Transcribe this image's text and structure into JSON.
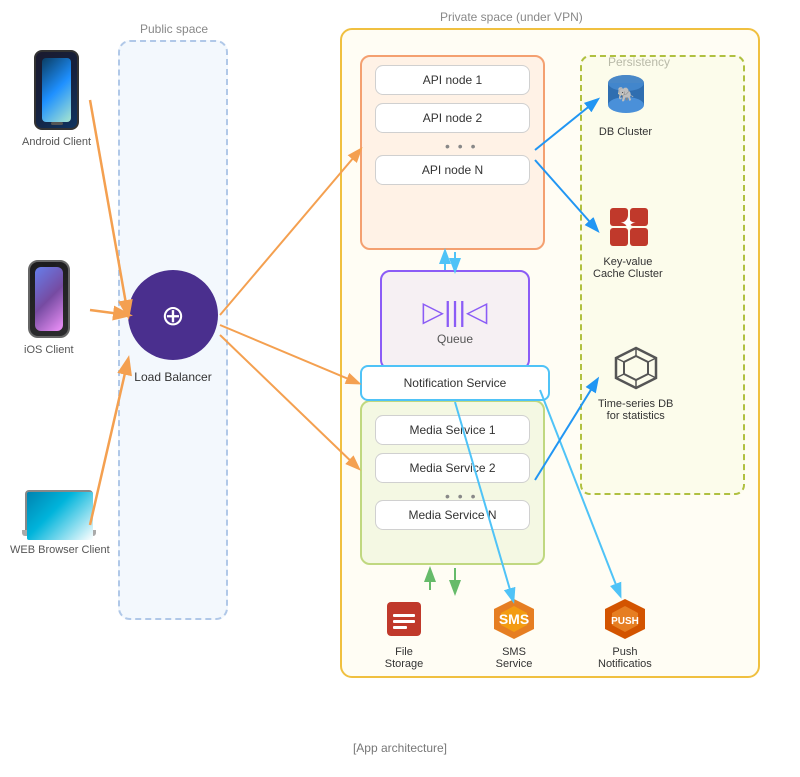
{
  "title": "App architecture",
  "zones": {
    "public_space": "Public space",
    "private_space": "Private space (under VPN)",
    "persistency": "Persistency"
  },
  "clients": [
    {
      "id": "android",
      "label": "Android Client",
      "type": "android"
    },
    {
      "id": "ios",
      "label": "iOS Client",
      "type": "ios"
    },
    {
      "id": "web",
      "label": "WEB Browser Client",
      "type": "laptop"
    }
  ],
  "load_balancer": {
    "label": "Load Balancer"
  },
  "api_nodes": [
    {
      "label": "API node 1"
    },
    {
      "label": "API node 2"
    },
    {
      "label": "..."
    },
    {
      "label": "API node N"
    }
  ],
  "queue": {
    "label": "Queue"
  },
  "notification_service": {
    "label": "Notification Service"
  },
  "media_services": [
    {
      "label": "Media Service 1"
    },
    {
      "label": "Media Service 2"
    },
    {
      "label": "..."
    },
    {
      "label": "Media Service N"
    }
  ],
  "persistence": [
    {
      "id": "db-cluster",
      "icon": "🐘",
      "label": "DB Cluster",
      "color": "#2f6eb0"
    },
    {
      "id": "cache-cluster",
      "icon": "🔴",
      "label": "Key-value\nCache Cluster",
      "color": "#c0392b"
    },
    {
      "id": "timeseries-db",
      "icon": "💎",
      "label": "Time-series DB\nfor statistics",
      "color": "#555"
    }
  ],
  "bottom_services": [
    {
      "id": "file-storage",
      "icon": "🟥",
      "label": "File\nStorage",
      "color": "#c0392b"
    },
    {
      "id": "sms-service",
      "icon": "🟧",
      "label": "SMS\nService",
      "color": "#e67e22"
    },
    {
      "id": "push-notifications",
      "icon": "🟧",
      "label": "Push\nNotificatios",
      "color": "#e67e22"
    }
  ],
  "caption": "[App architecture]"
}
